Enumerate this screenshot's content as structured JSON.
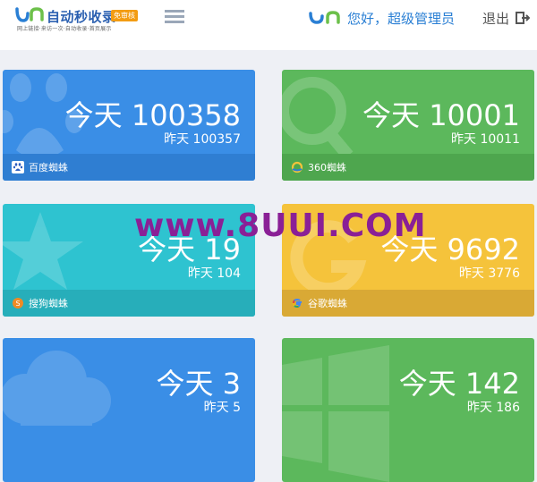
{
  "header": {
    "logo_title": "自动秒收录",
    "logo_badge": "免审核",
    "logo_slogan": "网上链接·来访一次·自动收录·首页展示",
    "greeting": "您好，超级管理员",
    "logout_label": "退出"
  },
  "cards": [
    {
      "today": "今天 100358",
      "yesterday": "昨天 100357",
      "name": "百度蜘蛛",
      "color": "#3a8ee6",
      "footer_color": "#2f7ed2"
    },
    {
      "today": "今天 10001",
      "yesterday": "昨天 10011",
      "name": "360蜘蛛",
      "color": "#5cb85c",
      "footer_color": "#4ea64e"
    },
    {
      "today": "今天 19",
      "yesterday": "昨天 104",
      "name": "搜狗蜘蛛",
      "color": "#2ec3d0",
      "footer_color": "#27aeba"
    },
    {
      "today": "今天 9692",
      "yesterday": "昨天 3776",
      "name": "谷歌蜘蛛",
      "color": "#f5c33b",
      "footer_color": "#d9a935"
    },
    {
      "today": "今天 3",
      "yesterday": "昨天 5",
      "color": "#3a8ee6"
    },
    {
      "today": "今天 142",
      "yesterday": "昨天 186",
      "color": "#5cb85c"
    }
  ],
  "watermark": "www.8UUI.COM"
}
